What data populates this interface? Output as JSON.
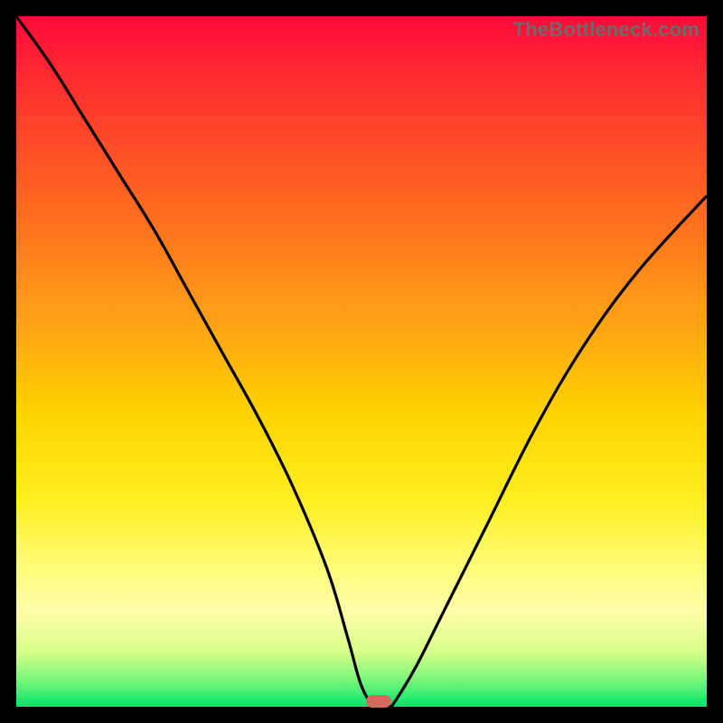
{
  "watermark": "TheBottleneck.com",
  "chart_data": {
    "type": "line",
    "title": "",
    "xlabel": "",
    "ylabel": "",
    "xlim": [
      0,
      100
    ],
    "ylim": [
      0,
      100
    ],
    "series": [
      {
        "name": "bottleneck-curve",
        "x": [
          0,
          5,
          10,
          15,
          20,
          25,
          30,
          35,
          40,
          45,
          48,
          50,
          52,
          54,
          55,
          58,
          62,
          68,
          75,
          82,
          90,
          100
        ],
        "values": [
          100,
          93,
          85,
          77,
          69,
          60,
          51,
          42,
          32,
          20,
          10,
          3,
          0,
          0,
          1,
          6,
          14,
          26,
          40,
          52,
          63,
          74
        ]
      }
    ],
    "marker": {
      "x": 52.5,
      "y": 0,
      "color": "#d46a5f"
    },
    "background_gradient": {
      "top": "#ff0a3a",
      "mid": "#ffee20",
      "bottom": "#00e56b"
    }
  }
}
